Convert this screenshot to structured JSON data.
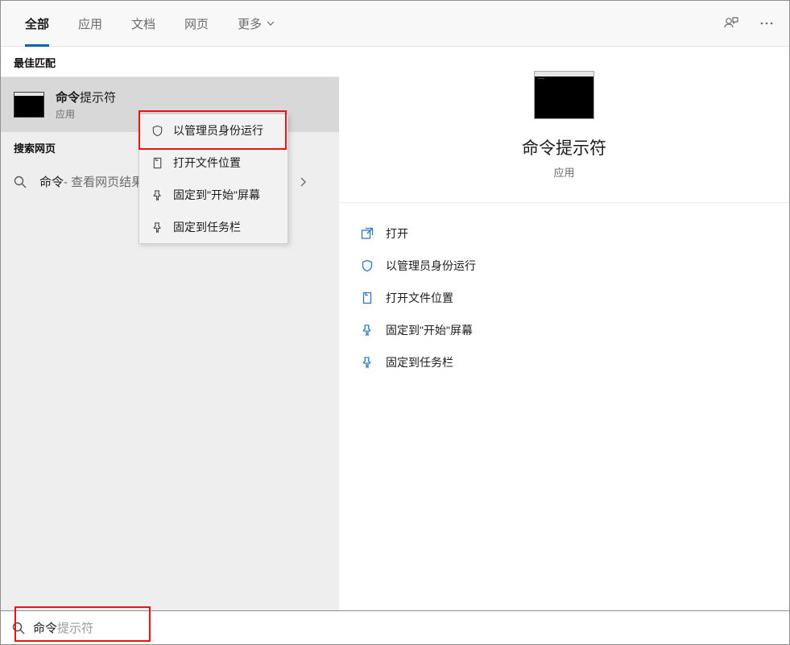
{
  "tabs": {
    "all": "全部",
    "apps": "应用",
    "docs": "文档",
    "web": "网页",
    "more": "更多"
  },
  "sections": {
    "best_match": "最佳匹配",
    "search_web": "搜索网页"
  },
  "best_match": {
    "query_part": "命令",
    "rest_part": "提示符",
    "subtitle": "应用"
  },
  "web_result": {
    "query": "命令",
    "hint": " - 查看网页结果"
  },
  "context_menu": {
    "run_admin": "以管理员身份运行",
    "open_location": "打开文件位置",
    "pin_start": "固定到\"开始\"屏幕",
    "pin_taskbar": "固定到任务栏"
  },
  "preview": {
    "title": "命令提示符",
    "subtitle": "应用"
  },
  "actions": {
    "open": "打开",
    "run_admin": "以管理员身份运行",
    "open_location": "打开文件位置",
    "pin_start": "固定到\"开始\"屏幕",
    "pin_taskbar": "固定到任务栏"
  },
  "search": {
    "typed": "命令",
    "ghost": "提示符"
  }
}
